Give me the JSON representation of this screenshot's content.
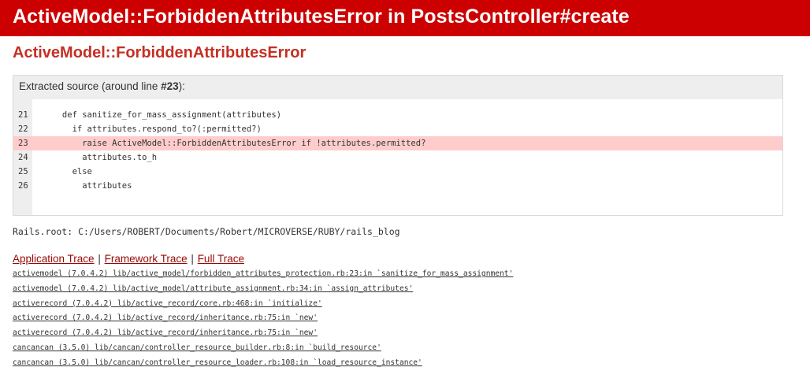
{
  "colors": {
    "header_bg": "#cc0000",
    "title": "#c52f24",
    "highlight": "#ffcccc",
    "link": "#980905"
  },
  "header": {
    "title": "ActiveModel::ForbiddenAttributesError in PostsController#create"
  },
  "error": {
    "title": "ActiveModel::ForbiddenAttributesError"
  },
  "source": {
    "label_prefix": "Extracted source (around line ",
    "line_ref": "#23",
    "label_suffix": "):",
    "highlight_line": "23",
    "lines": [
      {
        "num": "21",
        "code": "      def sanitize_for_mass_assignment(attributes)"
      },
      {
        "num": "22",
        "code": "        if attributes.respond_to?(:permitted?)"
      },
      {
        "num": "23",
        "code": "          raise ActiveModel::ForbiddenAttributesError if !attributes.permitted?"
      },
      {
        "num": "24",
        "code": "          attributes.to_h"
      },
      {
        "num": "25",
        "code": "        else"
      },
      {
        "num": "26",
        "code": "          attributes"
      }
    ]
  },
  "rails_root": {
    "text": "Rails.root: C:/Users/ROBERT/Documents/Robert/MICROVERSE/RUBY/rails_blog"
  },
  "trace_tabs": {
    "application": "Application Trace",
    "framework": "Framework Trace",
    "full": "Full Trace",
    "separator": "|"
  },
  "trace": [
    "activemodel (7.0.4.2) lib/active_model/forbidden_attributes_protection.rb:23:in `sanitize_for_mass_assignment'",
    "activemodel (7.0.4.2) lib/active_model/attribute_assignment.rb:34:in `assign_attributes'",
    "activerecord (7.0.4.2) lib/active_record/core.rb:468:in `initialize'",
    "activerecord (7.0.4.2) lib/active_record/inheritance.rb:75:in `new'",
    "activerecord (7.0.4.2) lib/active_record/inheritance.rb:75:in `new'",
    "cancancan (3.5.0) lib/cancan/controller_resource_builder.rb:8:in `build_resource'",
    "cancancan (3.5.0) lib/cancan/controller_resource_loader.rb:108:in `load_resource_instance'"
  ]
}
